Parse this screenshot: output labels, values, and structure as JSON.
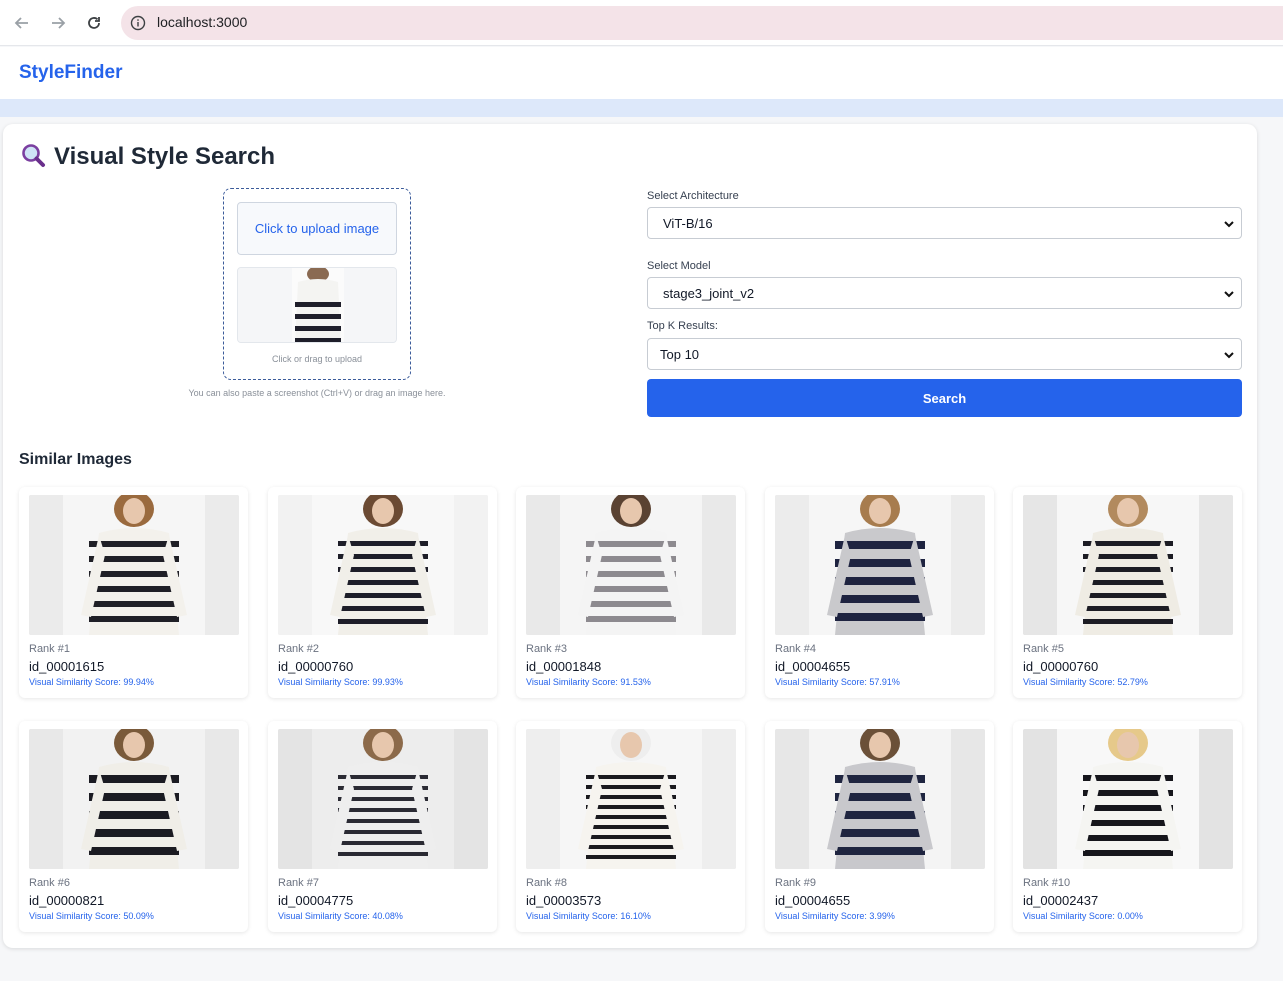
{
  "browser": {
    "url": "localhost:3000"
  },
  "app": {
    "brand": "StyleFinder"
  },
  "search_panel": {
    "title": "Visual Style Search",
    "upload_button": "Click to upload image",
    "upload_hint": "Click or drag to upload",
    "paste_hint": "You can also paste a screenshot (Ctrl+V) or drag an image here.",
    "architecture_label": "Select Architecture",
    "architecture_value": "ViT-B/16",
    "model_label": "Select Model",
    "model_value": "stage3_joint_v2",
    "topk_label": "Top K Results:",
    "topk_value": "Top 10",
    "search_button": "Search"
  },
  "results": {
    "title": "Similar Images",
    "items": [
      {
        "rank": "Rank #1",
        "id": "id_00001615",
        "score": "Visual Similarity Score: 99.94%"
      },
      {
        "rank": "Rank #2",
        "id": "id_00000760",
        "score": "Visual Similarity Score: 99.93%"
      },
      {
        "rank": "Rank #3",
        "id": "id_00001848",
        "score": "Visual Similarity Score: 91.53%"
      },
      {
        "rank": "Rank #4",
        "id": "id_00004655",
        "score": "Visual Similarity Score: 57.91%"
      },
      {
        "rank": "Rank #5",
        "id": "id_00000760",
        "score": "Visual Similarity Score: 52.79%"
      },
      {
        "rank": "Rank #6",
        "id": "id_00000821",
        "score": "Visual Similarity Score: 50.09%"
      },
      {
        "rank": "Rank #7",
        "id": "id_00004775",
        "score": "Visual Similarity Score: 40.08%"
      },
      {
        "rank": "Rank #8",
        "id": "id_00003573",
        "score": "Visual Similarity Score: 16.10%"
      },
      {
        "rank": "Rank #9",
        "id": "id_00004655",
        "score": "Visual Similarity Score: 3.99%"
      },
      {
        "rank": "Rank #10",
        "id": "id_00002437",
        "score": "Visual Similarity Score: 0.00%"
      }
    ]
  },
  "colors": {
    "accent": "#2563eb",
    "band": "#dde8fa",
    "address_bar": "#f4e3e8"
  },
  "icons": {
    "back": "arrow-left-icon",
    "forward": "arrow-right-icon",
    "reload": "reload-icon",
    "site_info": "info-icon",
    "title": "magnifier-icon",
    "select": "chevron-down-icon"
  }
}
